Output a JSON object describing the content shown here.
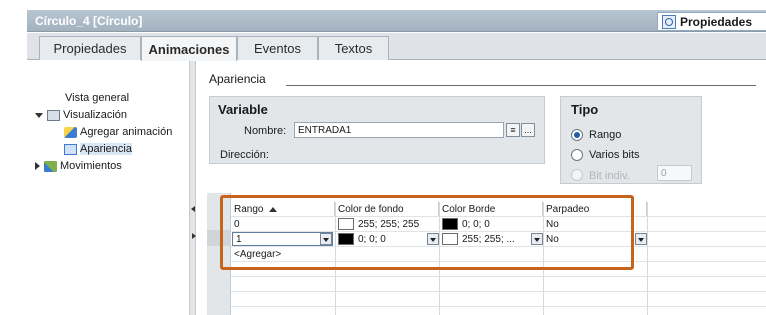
{
  "window": {
    "title": "Círculo_4 [Círculo]",
    "properties_button": "Propiedades"
  },
  "tabs": [
    {
      "label": "Propiedades"
    },
    {
      "label": "Animaciones"
    },
    {
      "label": "Eventos"
    },
    {
      "label": "Textos"
    }
  ],
  "tree": {
    "overview": "Vista general",
    "visualization": "Visualización",
    "add_animation": "Agregar animación",
    "appearance": "Apariencia",
    "movements": "Movimientos"
  },
  "section": {
    "title": "Apariencia"
  },
  "variable": {
    "title": "Variable",
    "name_label": "Nombre:",
    "name_value": "ENTRADA1",
    "browse_button": "...",
    "address_label": "Dirección:"
  },
  "tipo": {
    "title": "Tipo",
    "options": [
      "Rango",
      "Varios bits",
      "Bit indiv."
    ],
    "selected": "Rango",
    "bit_value": "0"
  },
  "grid": {
    "headers": [
      "Rango",
      "Color de fondo",
      "Color Borde",
      "Parpadeo"
    ],
    "rows": [
      {
        "range": "0",
        "bg_color": "255; 255; 255",
        "border_color": "0; 0; 0",
        "blink": "No"
      },
      {
        "range": "1",
        "bg_color": "0; 0; 0",
        "border_color": "255; 255; ...",
        "blink": "No"
      }
    ],
    "add_row": "<Agregar>"
  },
  "colors": {
    "highlight": "#c8631b",
    "white": "#ffffff",
    "black": "#000000"
  }
}
